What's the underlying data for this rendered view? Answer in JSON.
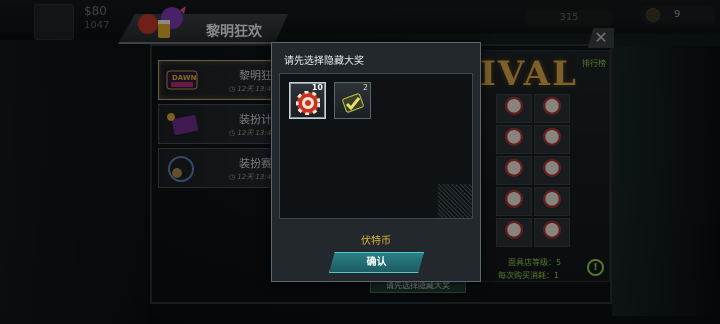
{
  "hud": {
    "money": "$80",
    "sub": "1047",
    "stat": "315",
    "coins": "9"
  },
  "window": {
    "title": "黎明狂欢",
    "close_icon": "close-icon"
  },
  "cards": [
    {
      "title": "黎明狂",
      "time": "12天 13:44",
      "icon": "dawn-sign-icon",
      "active": true
    },
    {
      "title": "装扮计",
      "time": "12天 13:44",
      "icon": "ticket-icon",
      "active": false
    },
    {
      "title": "装扮赛",
      "time": "12天 13:44",
      "icon": "clock-icon",
      "active": false
    }
  ],
  "shop": {
    "neon": "IVAL",
    "leaderboard": "排行榜",
    "level": "面具店等级：5",
    "cost": "每次购买消耗：1",
    "hint": "请先选择隐藏大奖",
    "info_icon": "info-icon"
  },
  "modal": {
    "title": "请先选择隐藏大奖",
    "items": [
      {
        "name": "chip-token-icon",
        "count": "10",
        "selected": true
      },
      {
        "name": "check-card-icon",
        "count": "2",
        "selected": false
      }
    ],
    "currency_label": "伏特币",
    "confirm_label": "确认"
  },
  "colors": {
    "accent_cyan": "#2b7f86",
    "currency_gold": "#e1b736",
    "shop_green": "#8fd04d"
  }
}
